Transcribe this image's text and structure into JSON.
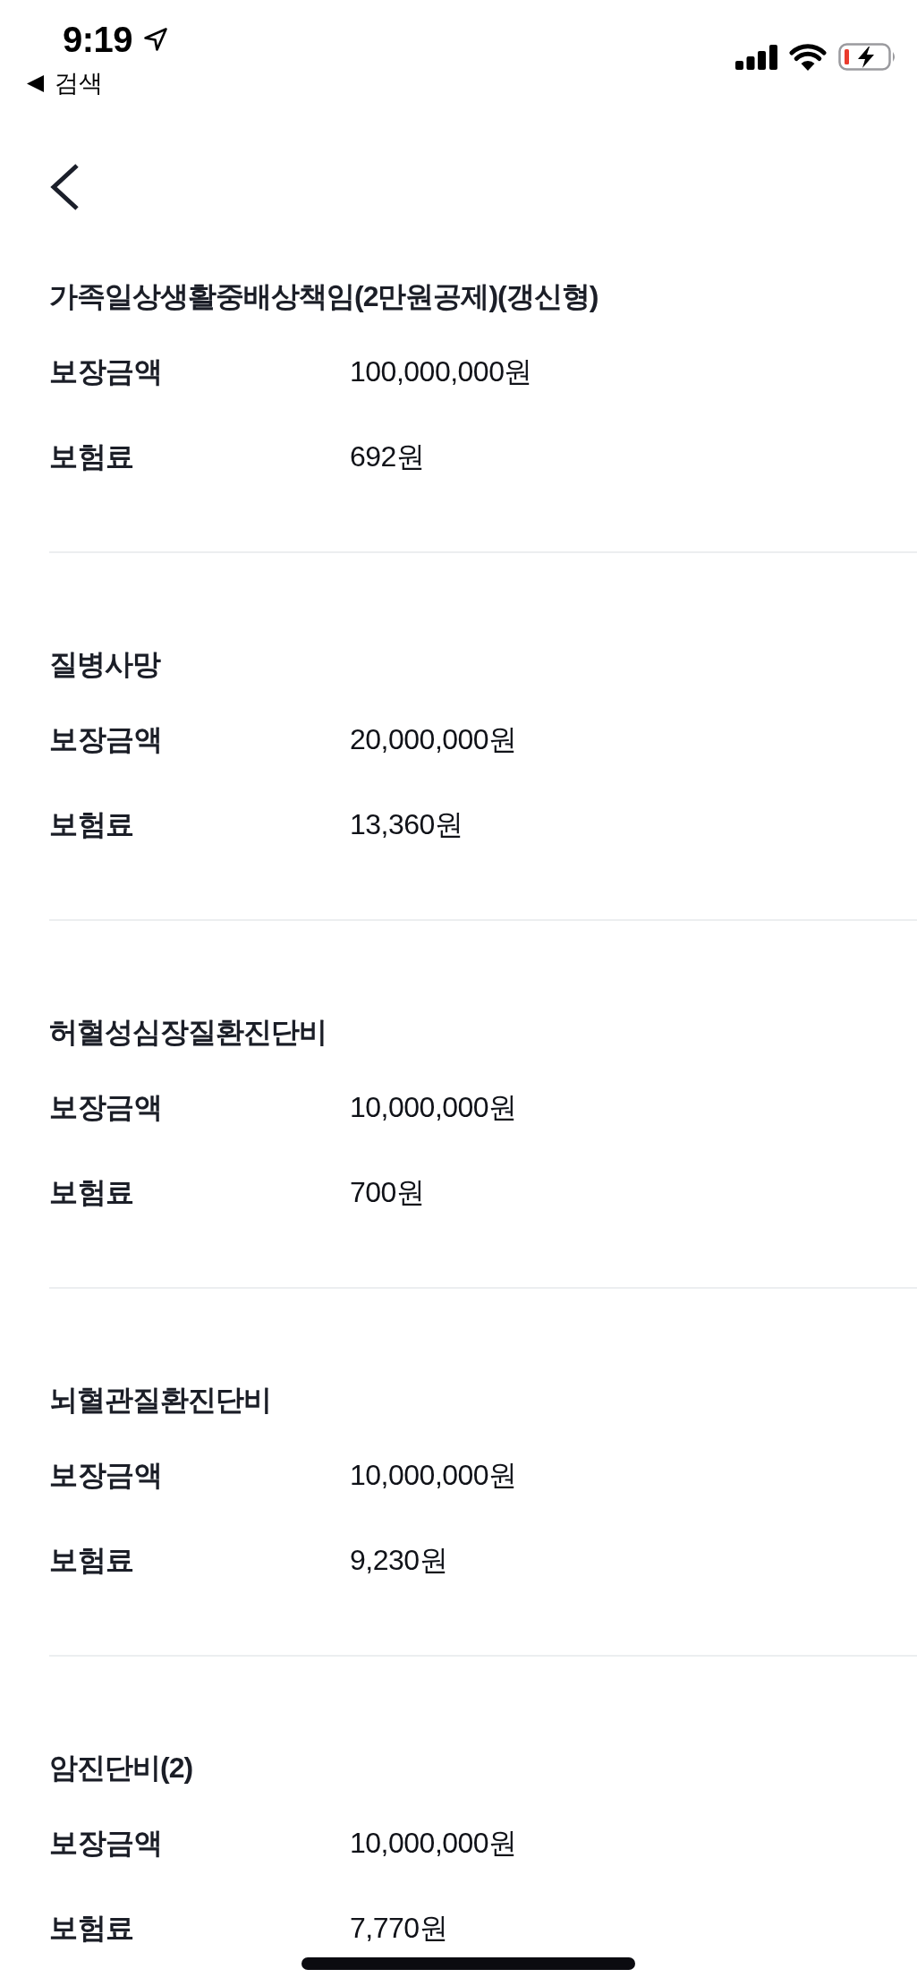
{
  "status_bar": {
    "time": "9:19",
    "back_app": "검색"
  },
  "coverages": [
    {
      "title": "가족일상생활중배상책임(2만원공제)(갱신형)",
      "rows": [
        {
          "label": "보장금액",
          "value": "100,000,000원"
        },
        {
          "label": "보험료",
          "value": "692원"
        }
      ]
    },
    {
      "title": "질병사망",
      "rows": [
        {
          "label": "보장금액",
          "value": "20,000,000원"
        },
        {
          "label": "보험료",
          "value": "13,360원"
        }
      ]
    },
    {
      "title": "허혈성심장질환진단비",
      "rows": [
        {
          "label": "보장금액",
          "value": "10,000,000원"
        },
        {
          "label": "보험료",
          "value": "700원"
        }
      ]
    },
    {
      "title": "뇌혈관질환진단비",
      "rows": [
        {
          "label": "보장금액",
          "value": "10,000,000원"
        },
        {
          "label": "보험료",
          "value": "9,230원"
        }
      ]
    },
    {
      "title": "암진단비(2)",
      "rows": [
        {
          "label": "보장금액",
          "value": "10,000,000원"
        },
        {
          "label": "보험료",
          "value": "7,770원"
        }
      ]
    }
  ]
}
